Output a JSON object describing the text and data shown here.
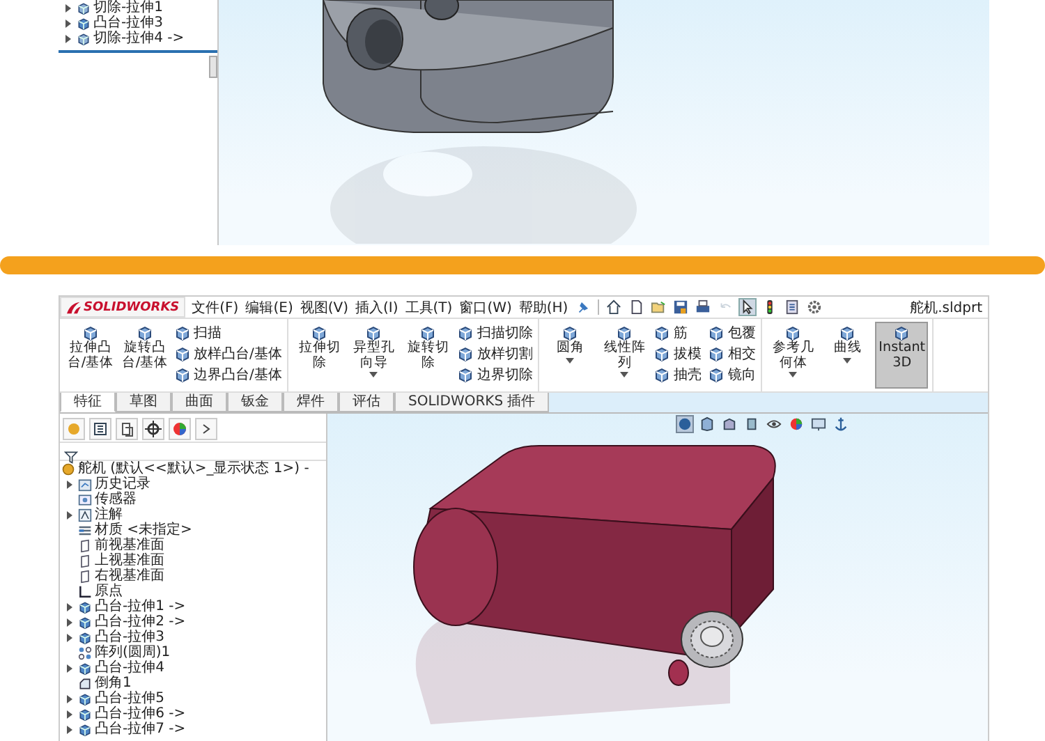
{
  "top_panel": {
    "tree_items": [
      {
        "label": "切除-拉伸1",
        "kind": "cut",
        "has_children": true
      },
      {
        "label": "凸台-拉伸3",
        "kind": "boss",
        "has_children": true
      },
      {
        "label": "切除-拉伸4 ->",
        "kind": "cut",
        "has_children": true
      }
    ]
  },
  "app": {
    "logo": "SOLIDWORKS",
    "menu": [
      "文件(F)",
      "编辑(E)",
      "视图(V)",
      "插入(I)",
      "工具(T)",
      "窗口(W)",
      "帮助(H)"
    ],
    "document_title": "舵机.sldprt",
    "command_groups": [
      {
        "items": [
          {
            "kind": "large",
            "label": "拉伸凸台/基体",
            "dropdown": false,
            "selected": false
          },
          {
            "kind": "large",
            "label": "旋转凸台/基体",
            "dropdown": false,
            "selected": false
          },
          {
            "kind": "small",
            "label": "扫描"
          },
          {
            "kind": "small",
            "label": "放样凸台/基体"
          },
          {
            "kind": "small",
            "label": "边界凸台/基体"
          }
        ]
      },
      {
        "items": [
          {
            "kind": "large",
            "label": "拉伸切除",
            "dropdown": false,
            "selected": false
          },
          {
            "kind": "large",
            "label": "异型孔向导",
            "dropdown": true,
            "selected": false
          },
          {
            "kind": "large",
            "label": "旋转切除",
            "dropdown": false,
            "selected": false
          },
          {
            "kind": "small",
            "label": "扫描切除"
          },
          {
            "kind": "small",
            "label": "放样切割"
          },
          {
            "kind": "small",
            "label": "边界切除"
          }
        ]
      },
      {
        "items": [
          {
            "kind": "large",
            "label": "圆角",
            "dropdown": true,
            "selected": false
          },
          {
            "kind": "large",
            "label": "线性阵列",
            "dropdown": true,
            "selected": false
          },
          {
            "kind": "small",
            "label": "筋"
          },
          {
            "kind": "small",
            "label": "拔模"
          },
          {
            "kind": "small",
            "label": "抽壳"
          },
          {
            "kind": "small",
            "label": "包覆"
          },
          {
            "kind": "small",
            "label": "相交"
          },
          {
            "kind": "small",
            "label": "镜向"
          }
        ]
      },
      {
        "items": [
          {
            "kind": "large",
            "label": "参考几何体",
            "dropdown": true,
            "selected": false
          },
          {
            "kind": "large",
            "label": "曲线",
            "dropdown": true,
            "selected": false
          },
          {
            "kind": "large",
            "label": "Instant3D",
            "dropdown": false,
            "selected": true
          }
        ]
      }
    ],
    "tabs": [
      {
        "label": "特征",
        "selected": true
      },
      {
        "label": "草图",
        "selected": false
      },
      {
        "label": "曲面",
        "selected": false
      },
      {
        "label": "钣金",
        "selected": false
      },
      {
        "label": "焊件",
        "selected": false
      },
      {
        "label": "评估",
        "selected": false
      },
      {
        "label": "SOLIDWORKS 插件",
        "selected": false
      }
    ],
    "feature_tree": {
      "root": "舵机  (默认<<默认>_显示状态 1>) -",
      "items": [
        {
          "label": "历史记录",
          "kind": "history",
          "has_children": true
        },
        {
          "label": "传感器",
          "kind": "sensor",
          "has_children": false
        },
        {
          "label": "注解",
          "kind": "annotation",
          "has_children": true
        },
        {
          "label": "材质 <未指定>",
          "kind": "material",
          "has_children": false
        },
        {
          "label": "前视基准面",
          "kind": "plane",
          "has_children": false
        },
        {
          "label": "上视基准面",
          "kind": "plane",
          "has_children": false
        },
        {
          "label": "右视基准面",
          "kind": "plane",
          "has_children": false
        },
        {
          "label": "原点",
          "kind": "origin",
          "has_children": false
        },
        {
          "label": "凸台-拉伸1 ->",
          "kind": "boss",
          "has_children": true
        },
        {
          "label": "凸台-拉伸2 ->",
          "kind": "boss",
          "has_children": true
        },
        {
          "label": "凸台-拉伸3",
          "kind": "boss",
          "has_children": true
        },
        {
          "label": "阵列(圆周)1",
          "kind": "pattern",
          "has_children": false
        },
        {
          "label": "凸台-拉伸4",
          "kind": "boss",
          "has_children": true
        },
        {
          "label": "倒角1",
          "kind": "chamfer",
          "has_children": false
        },
        {
          "label": "凸台-拉伸5",
          "kind": "boss",
          "has_children": true
        },
        {
          "label": "凸台-拉伸6 ->",
          "kind": "boss",
          "has_children": true
        },
        {
          "label": "凸台-拉伸7 ->",
          "kind": "boss",
          "has_children": true
        }
      ]
    }
  }
}
